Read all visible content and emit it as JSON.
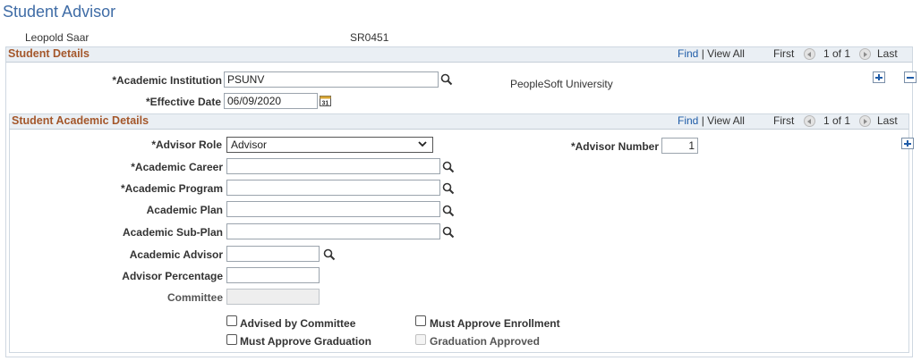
{
  "page": {
    "title": "Student Advisor"
  },
  "header": {
    "student_name": "Leopold Saar",
    "student_id": "SR0451"
  },
  "student_details": {
    "title": "Student Details",
    "nav": {
      "find": "Find",
      "sep": "|",
      "view_all": "View All",
      "first": "First",
      "count": "1 of 1",
      "last": "Last"
    },
    "institution_label": "*Academic Institution",
    "institution_value": "PSUNV",
    "institution_desc": "PeopleSoft University",
    "effdt_label": "*Effective Date",
    "effdt_value": "06/09/2020"
  },
  "academic_details": {
    "title": "Student Academic Details",
    "nav": {
      "find": "Find",
      "sep": "|",
      "view_all": "View All",
      "first": "First",
      "count": "1 of 1",
      "last": "Last"
    },
    "advisor_role_label": "*Advisor Role",
    "advisor_role_value": "Advisor",
    "advisor_number_label": "*Advisor Number",
    "advisor_number_value": "1",
    "career_label": "*Academic Career",
    "career_value": "",
    "program_label": "*Academic Program",
    "program_value": "",
    "plan_label": "Academic Plan",
    "plan_value": "",
    "subplan_label": "Academic Sub-Plan",
    "subplan_value": "",
    "advisor_label": "Academic Advisor",
    "advisor_value": "",
    "percentage_label": "Advisor Percentage",
    "percentage_value": "",
    "committee_label": "Committee",
    "committee_value": "",
    "checkboxes": {
      "advised_by_committee": "Advised by Committee",
      "must_approve_enrollment": "Must Approve Enrollment",
      "must_approve_graduation": "Must Approve Graduation",
      "graduation_approved": "Graduation Approved"
    }
  },
  "icons": {
    "lookup": "magnifier-icon",
    "calendar": "calendar-icon",
    "add": "plus-icon",
    "delete": "minus-icon",
    "prev": "arrow-left-icon",
    "next": "arrow-right-icon"
  },
  "colors": {
    "title": "#3f6ca6",
    "section_title": "#a4572b",
    "link": "#1f5ca8",
    "section_bg": "#eaeff4"
  }
}
